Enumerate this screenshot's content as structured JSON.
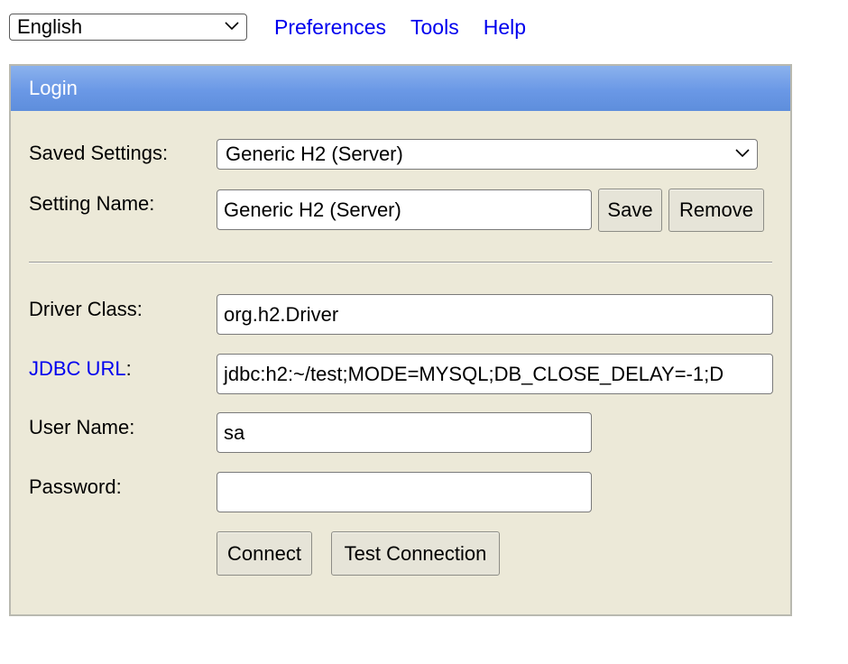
{
  "topbar": {
    "language": {
      "selected": "English",
      "icon": "chevron-down-icon"
    },
    "links": {
      "preferences": "Preferences",
      "tools": "Tools",
      "help": "Help"
    }
  },
  "panel": {
    "title": "Login",
    "saved_settings": {
      "label": "Saved Settings:",
      "selected": "Generic H2 (Server)",
      "icon": "chevron-down-icon"
    },
    "setting_name": {
      "label": "Setting Name:",
      "value": "Generic H2 (Server)",
      "save_label": "Save",
      "remove_label": "Remove"
    },
    "driver_class": {
      "label": "Driver Class:",
      "value": "org.h2.Driver"
    },
    "jdbc_url": {
      "label_link": "JDBC URL",
      "label_suffix": ":",
      "value": "jdbc:h2:~/test;MODE=MYSQL;DB_CLOSE_DELAY=-1;D"
    },
    "user_name": {
      "label": "User Name:",
      "value": "sa"
    },
    "password": {
      "label": "Password:",
      "value": ""
    },
    "actions": {
      "connect_label": "Connect",
      "test_connection_label": "Test Connection"
    }
  },
  "colors": {
    "header_gradient_top": "#8bb2ed",
    "header_gradient_bottom": "#5e8edc",
    "panel_background": "#ece9d8",
    "link": "#0000ee"
  }
}
